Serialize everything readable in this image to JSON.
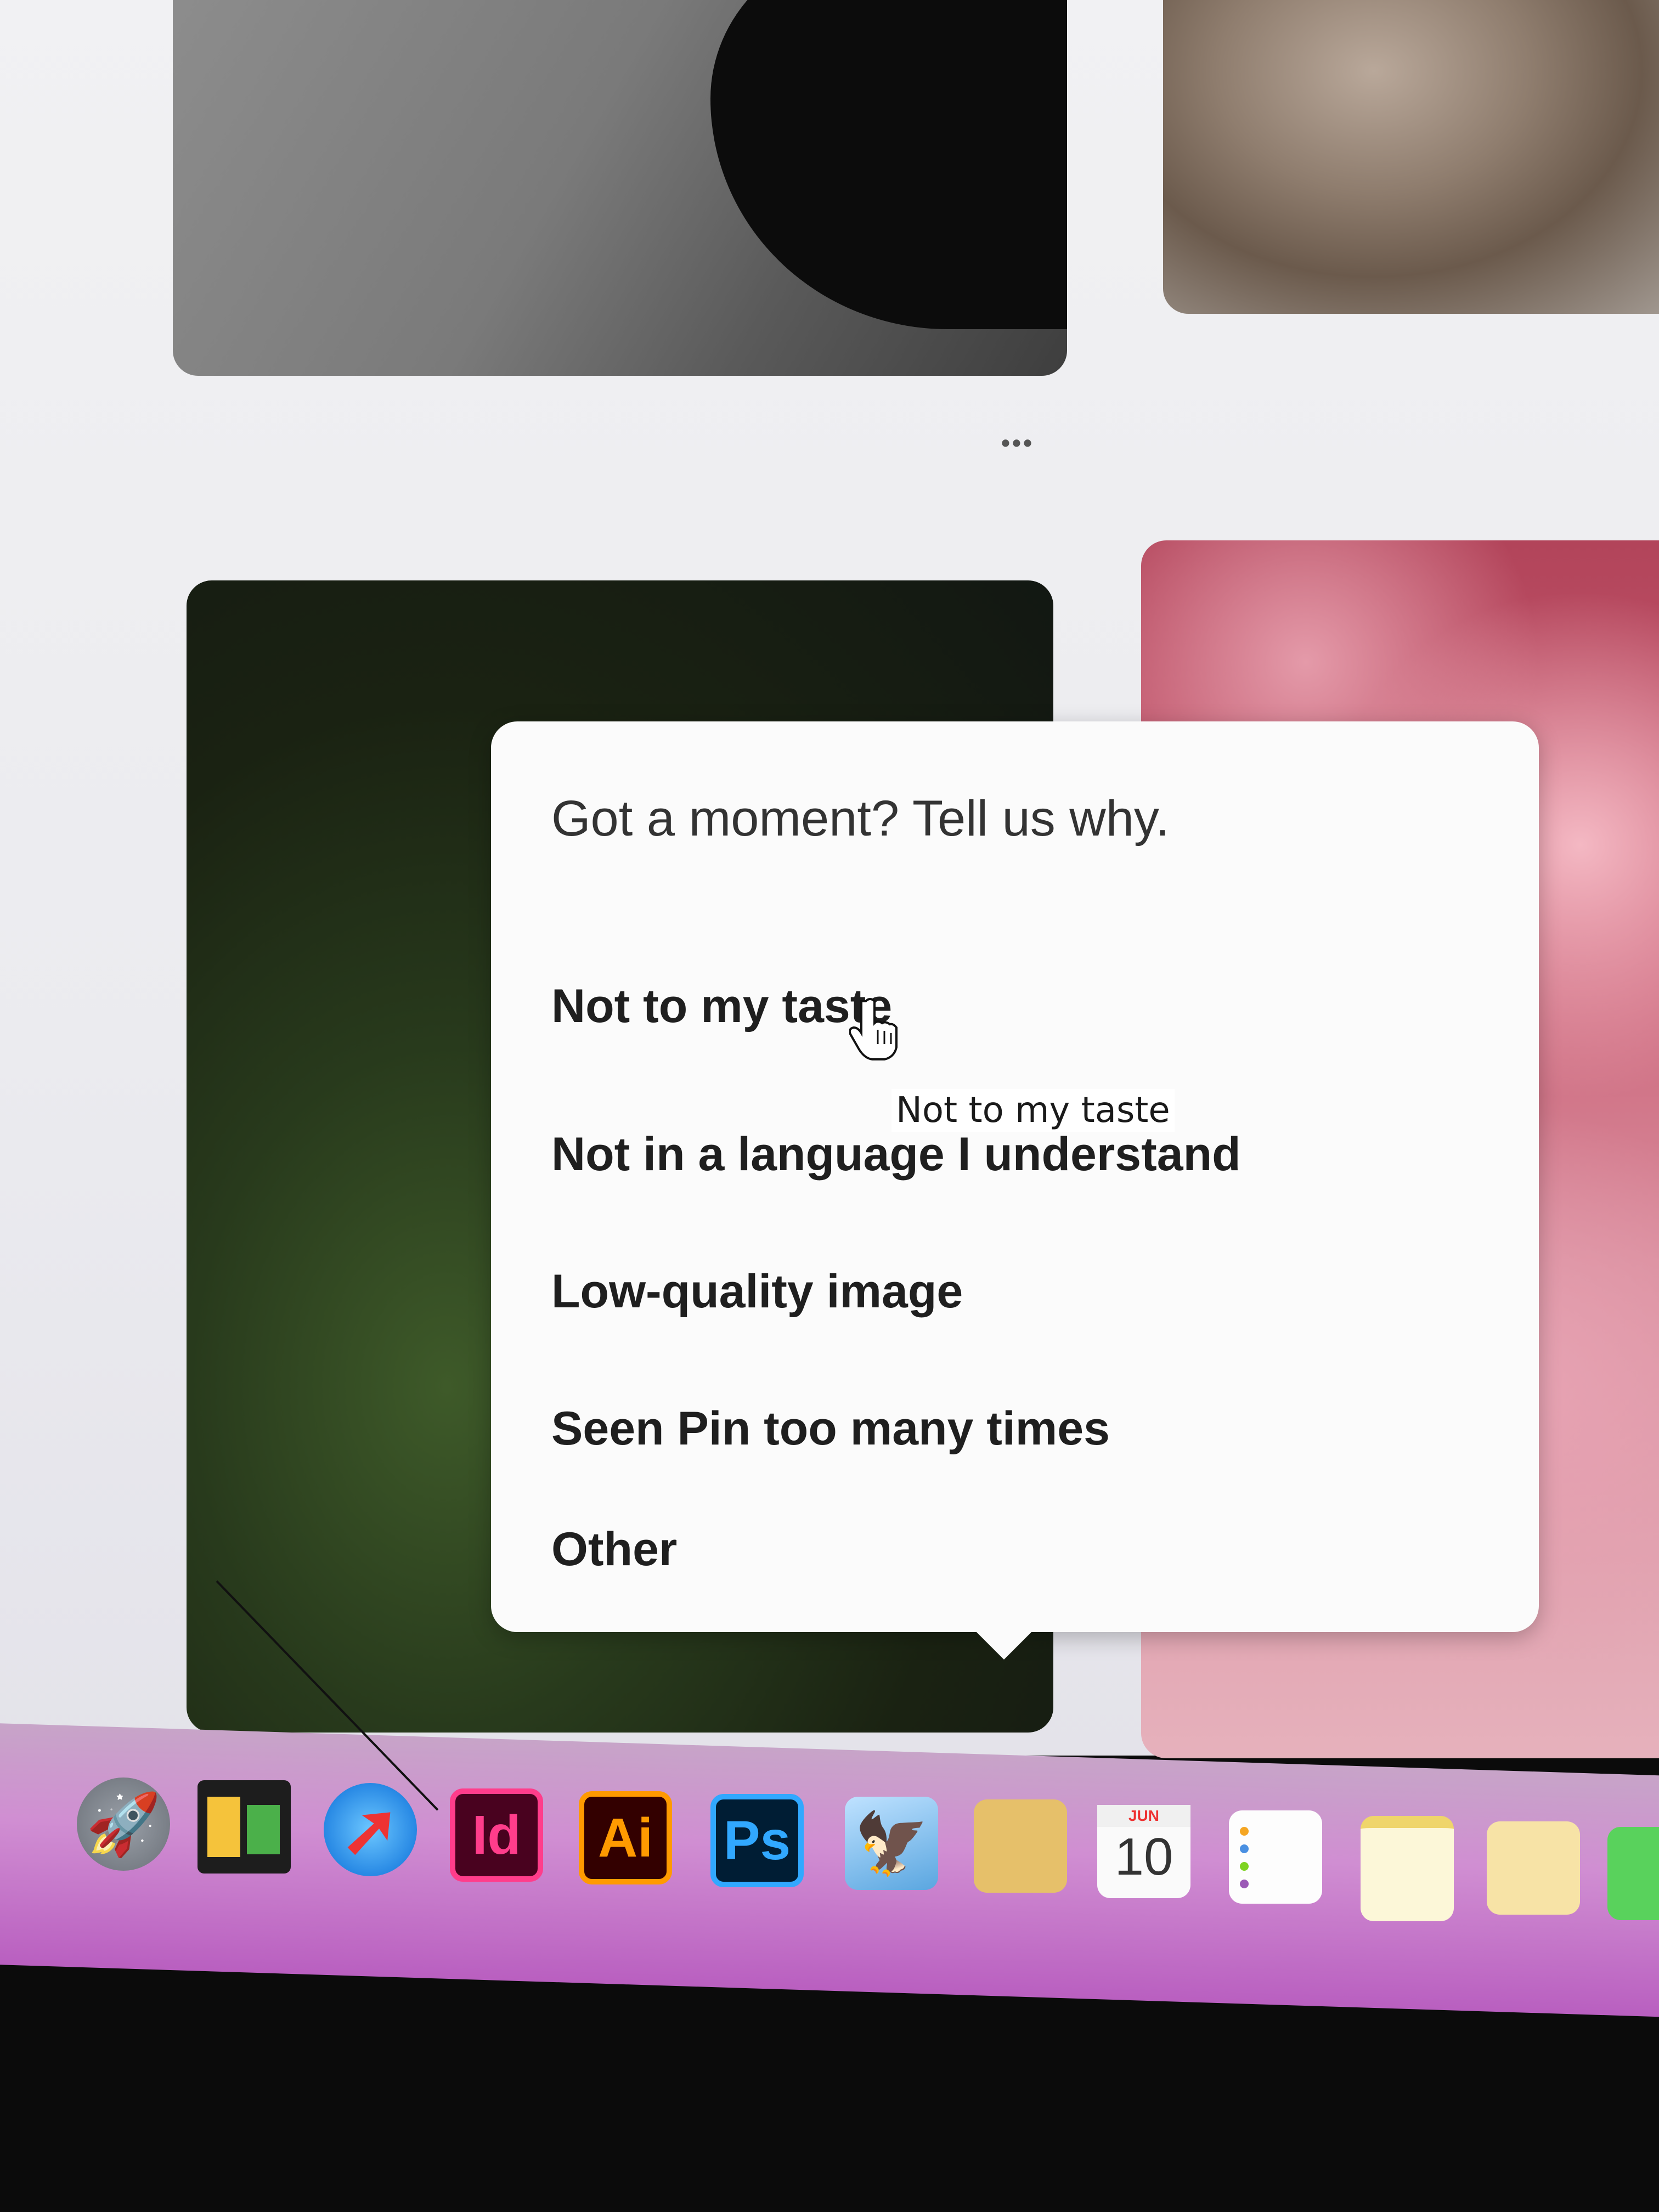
{
  "feed": {
    "more_label": "•••"
  },
  "popover": {
    "title": "Got a moment? Tell us why.",
    "options": [
      "Not to my taste",
      "Not in a language I understand",
      "Low-quality image",
      "Seen Pin too many times",
      "Other"
    ],
    "tooltip": "Not to my taste"
  },
  "dock": {
    "launchpad_icon": "rocket-icon",
    "mission_control_icon": "mission-control-icon",
    "safari_icon": "compass-icon",
    "indesign_label": "Id",
    "illustrator_label": "Ai",
    "photoshop_label": "Ps",
    "preview_icon": "preview-icon",
    "calendar_month": "JUN",
    "calendar_day": "10"
  },
  "colors": {
    "indesign": "#ff3d8b",
    "illustrator": "#ff9a00",
    "photoshop": "#31a8ff",
    "popover_bg": "#fbfbfb"
  }
}
